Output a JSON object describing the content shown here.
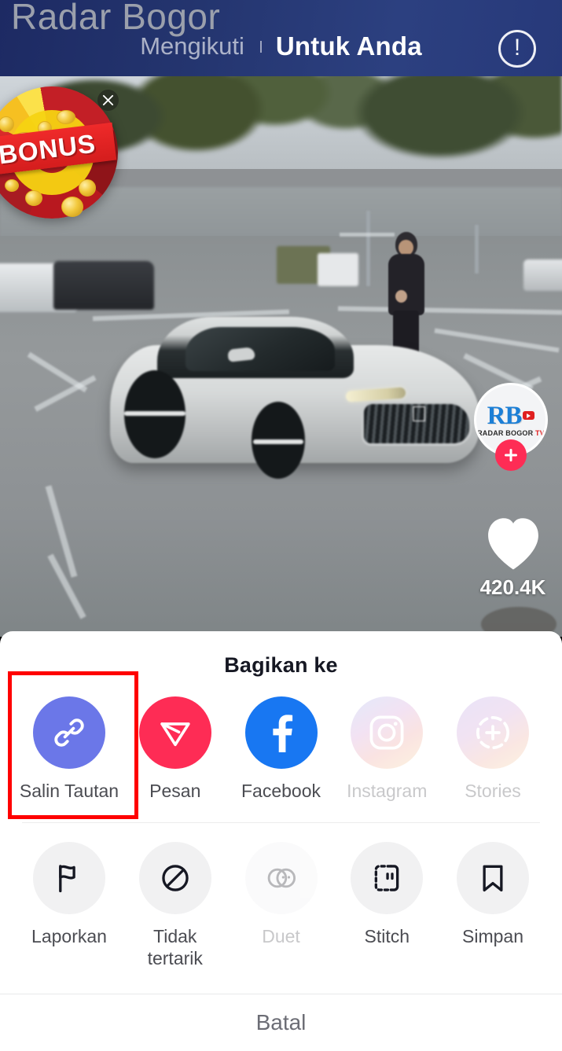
{
  "app": {
    "watermark": "Radar Bogor"
  },
  "topbar": {
    "tab_following": "Mengikuti",
    "tab_foryou": "Untuk Anda",
    "info_icon": "exclamation-circle-icon",
    "bg_color": "#27397a"
  },
  "ad": {
    "badge_text": "BONUS",
    "close_icon": "close-x-icon"
  },
  "video": {
    "description": "white concept supercar parked in a lot with a person standing beside it"
  },
  "actions": {
    "avatar": {
      "initials": "RB",
      "caption": "RADAR BOGOR",
      "caption_accent": "TV",
      "follow_icon": "plus-icon"
    },
    "like": {
      "icon": "heart-icon",
      "count": "420.4K"
    }
  },
  "share_sheet": {
    "title": "Bagikan ke",
    "share_targets": [
      {
        "label": "Salin Tautan",
        "icon": "link-chain-icon",
        "color": "#6b77e8",
        "dim": false,
        "highlighted": true
      },
      {
        "label": "Pesan",
        "icon": "send-triangle-icon",
        "color": "#fe2c55",
        "dim": false,
        "highlighted": false
      },
      {
        "label": "Facebook",
        "icon": "facebook-f-icon",
        "color": "#1877f2",
        "dim": false,
        "highlighted": false
      },
      {
        "label": "Instagram",
        "icon": "instagram-icon",
        "color": "#d7a3d9",
        "dim": true,
        "highlighted": false
      },
      {
        "label": "Stories",
        "icon": "story-plus-icon",
        "color": "#d3a4d8",
        "dim": true,
        "highlighted": false
      }
    ],
    "actions": [
      {
        "label": "Laporkan",
        "icon": "flag-icon",
        "dim": false
      },
      {
        "label": "Tidak\ntertarik",
        "icon": "block-icon",
        "dim": false
      },
      {
        "label": "Duet",
        "icon": "duet-icon",
        "dim": true
      },
      {
        "label": "Stitch",
        "icon": "stitch-icon",
        "dim": false
      },
      {
        "label": "Simpan",
        "icon": "bookmark-icon",
        "dim": false
      }
    ],
    "cancel_label": "Batal",
    "highlight_color": "#ff0000"
  }
}
